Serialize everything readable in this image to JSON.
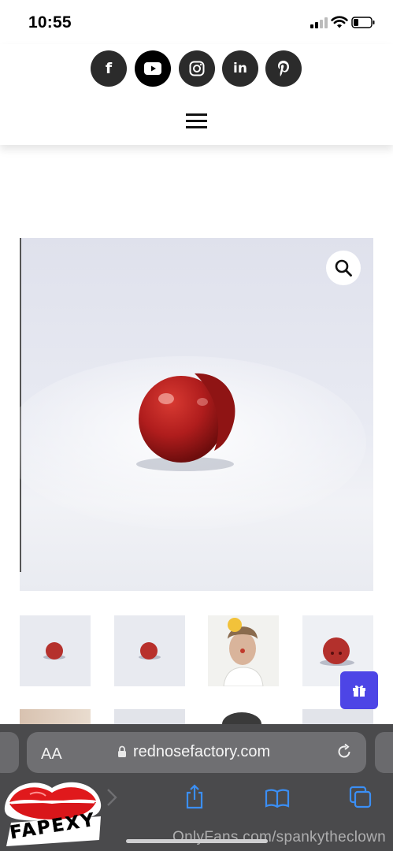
{
  "status_bar": {
    "time": "10:55"
  },
  "header": {
    "social": [
      {
        "name": "facebook",
        "glyph": "f"
      },
      {
        "name": "youtube",
        "glyph": "▶"
      },
      {
        "name": "instagram",
        "glyph": "◎"
      },
      {
        "name": "linkedin",
        "glyph": "in"
      },
      {
        "name": "pinterest",
        "glyph": "P"
      }
    ]
  },
  "product": {
    "main_image": "red-clown-nose-photo",
    "thumbnails": [
      "red-nose-thumb",
      "red-nose-thumb",
      "person-portrait-thumb",
      "red-nose-closeup-thumb"
    ]
  },
  "browser": {
    "aa_label": "AA",
    "url": "rednosefactory.com"
  },
  "overlay": {
    "logo_text": "FAPEXY",
    "watermark": "OnlyFans.com/spankytheclown"
  },
  "colors": {
    "accent": "#4d45e6",
    "nose_red": "#b01d1d",
    "browser_bg": "#4a4a4c"
  }
}
